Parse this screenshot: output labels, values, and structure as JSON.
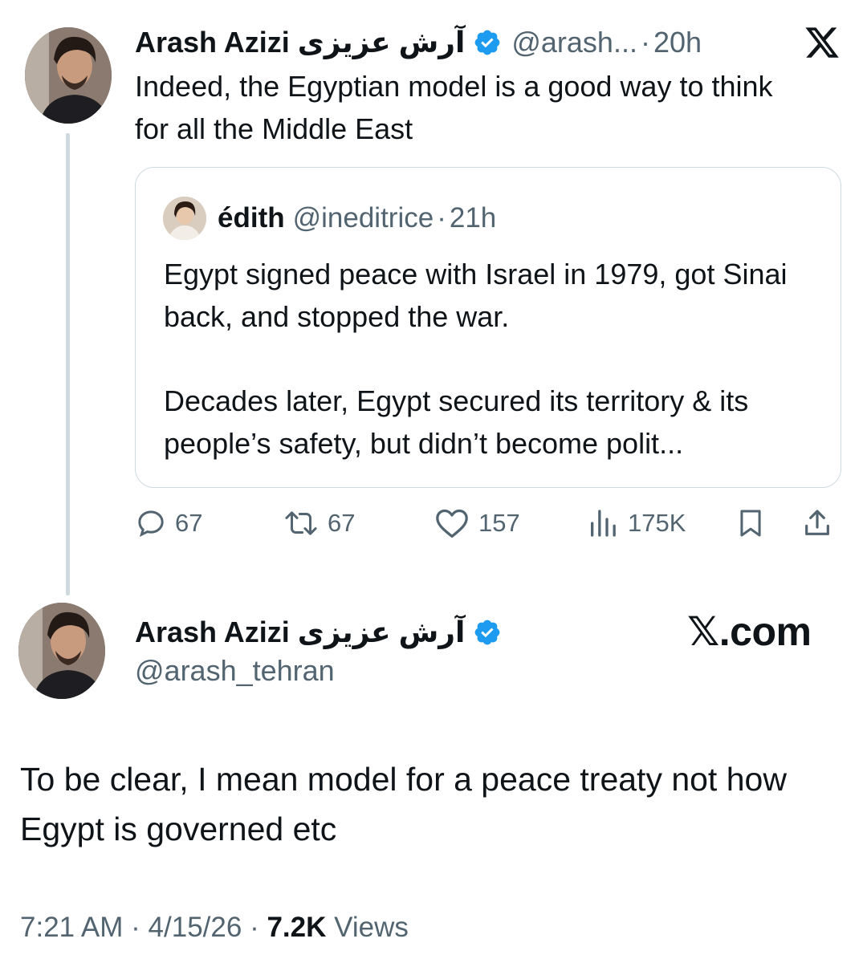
{
  "reply": {
    "author_name": "Arash Azizi",
    "author_name_rtl": "آرش عزیزی",
    "handle": "@arash...",
    "separator": "·",
    "time": "20h",
    "text": "Indeed, the Egyptian model is a good way to think for all the Middle East",
    "quote": {
      "author_name": "édith",
      "handle": "@ineditrice",
      "separator": "·",
      "time": "21h",
      "paragraph_1": "Egypt signed peace with Israel in 1979, got Sinai back, and stopped the war.",
      "paragraph_2": "Decades later, Egypt secured its territory & its people’s safety, but didn’t become polit..."
    },
    "actions": {
      "replies": "67",
      "reposts": "67",
      "likes": "157",
      "views": "175K"
    }
  },
  "main": {
    "author_name": "Arash Azizi",
    "author_name_rtl": "آرش عزیزی",
    "handle": "@arash_tehran",
    "text": "To be clear, I mean model for a peace treaty not how Egypt is governed etc",
    "time": "7:21 AM",
    "separator": "·",
    "date": "4/15/26",
    "separator2": "·",
    "views_count": "7.2K",
    "views_label": "Views"
  },
  "branding": {
    "watermark": "𝕏.com"
  },
  "icons": {
    "verified": "verified-badge-icon",
    "x_logo": "x-logo-icon",
    "reply": "reply-icon",
    "repost": "repost-icon",
    "like": "heart-icon",
    "views": "views-bar-icon",
    "bookmark": "bookmark-icon",
    "share": "share-icon"
  },
  "colors": {
    "text": "#0f1419",
    "muted": "#536471",
    "verified": "#1d9bf0",
    "border": "#cfd9de"
  }
}
